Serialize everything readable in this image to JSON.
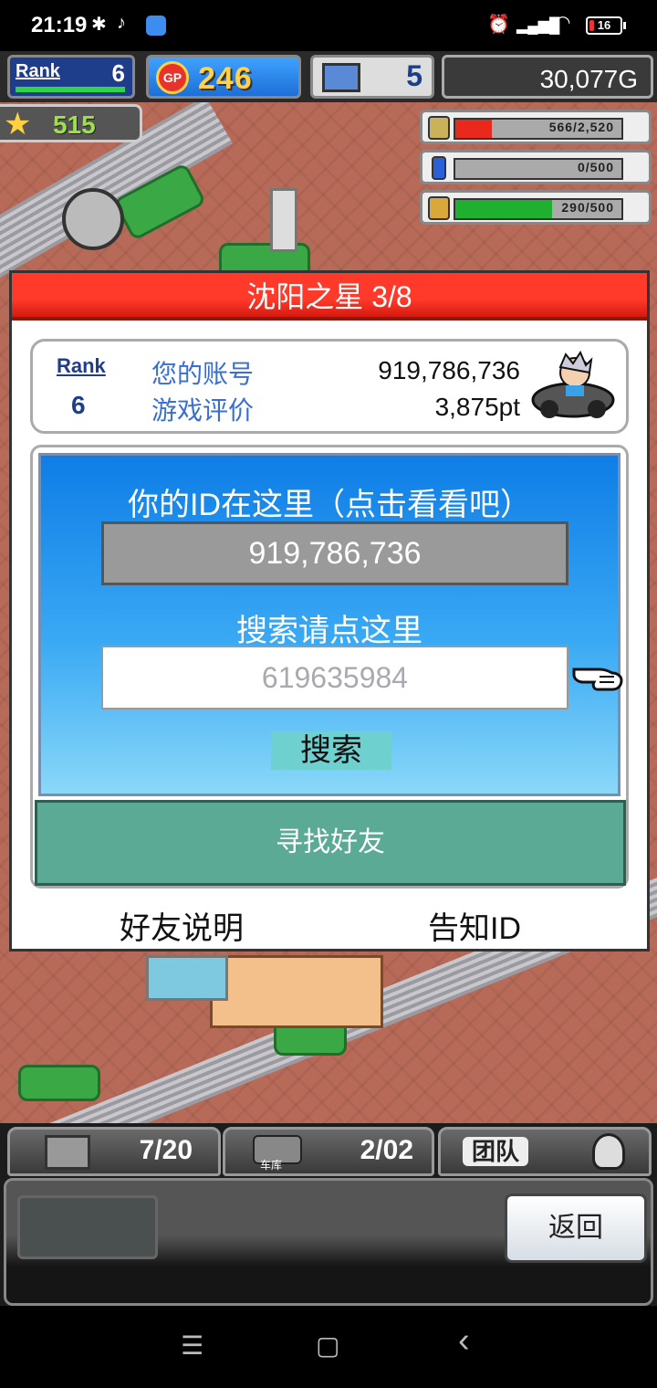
{
  "status_bar": {
    "time": "21:19",
    "battery": "16",
    "battery_level": 0.16
  },
  "hud": {
    "rank_label": "Rank",
    "rank_value": "6",
    "gp_badge": "GP",
    "gp_value": "246",
    "pc_value": "5",
    "gold": "30,077G",
    "stars": "515",
    "resources": [
      {
        "icon": "coin-stack-icon",
        "text": "566/2,520",
        "level": 0.22,
        "color": "#e8291c"
      },
      {
        "icon": "bottle-icon",
        "text": "0/500",
        "level": 0.0,
        "color": "#2a5fd8"
      },
      {
        "icon": "wheat-icon",
        "text": "290/500",
        "level": 0.58,
        "color": "#1fb02f"
      }
    ]
  },
  "dialog": {
    "title": "沈阳之星 3/8",
    "account": {
      "rank_label": "Rank",
      "rank_value": "6",
      "id_label": "您的账号",
      "id_value": "919,786,736",
      "rating_label": "游戏评价",
      "rating_value": "3,875pt"
    },
    "search": {
      "id_caption": "你的ID在这里（点击看看吧）",
      "id_value": "919,786,736",
      "search_caption": "搜索请点这里",
      "search_value": "619635984",
      "search_button": "搜索",
      "find_friends_button": "寻找好友"
    },
    "links": {
      "friend_help": "好友说明",
      "share_id": "告知ID"
    }
  },
  "bottom_bar": {
    "storage_count": "7/20",
    "garage_label": "车库",
    "garage_count": "2/02",
    "team_label": "团队",
    "back_button": "返回"
  },
  "nav_bar": {
    "menu": "☰",
    "home": "▢",
    "back": "‹"
  },
  "colors": {
    "title_red": "#ff3a2a",
    "find_button": "#5aaa96",
    "panel_blue": "#0e7de6"
  }
}
